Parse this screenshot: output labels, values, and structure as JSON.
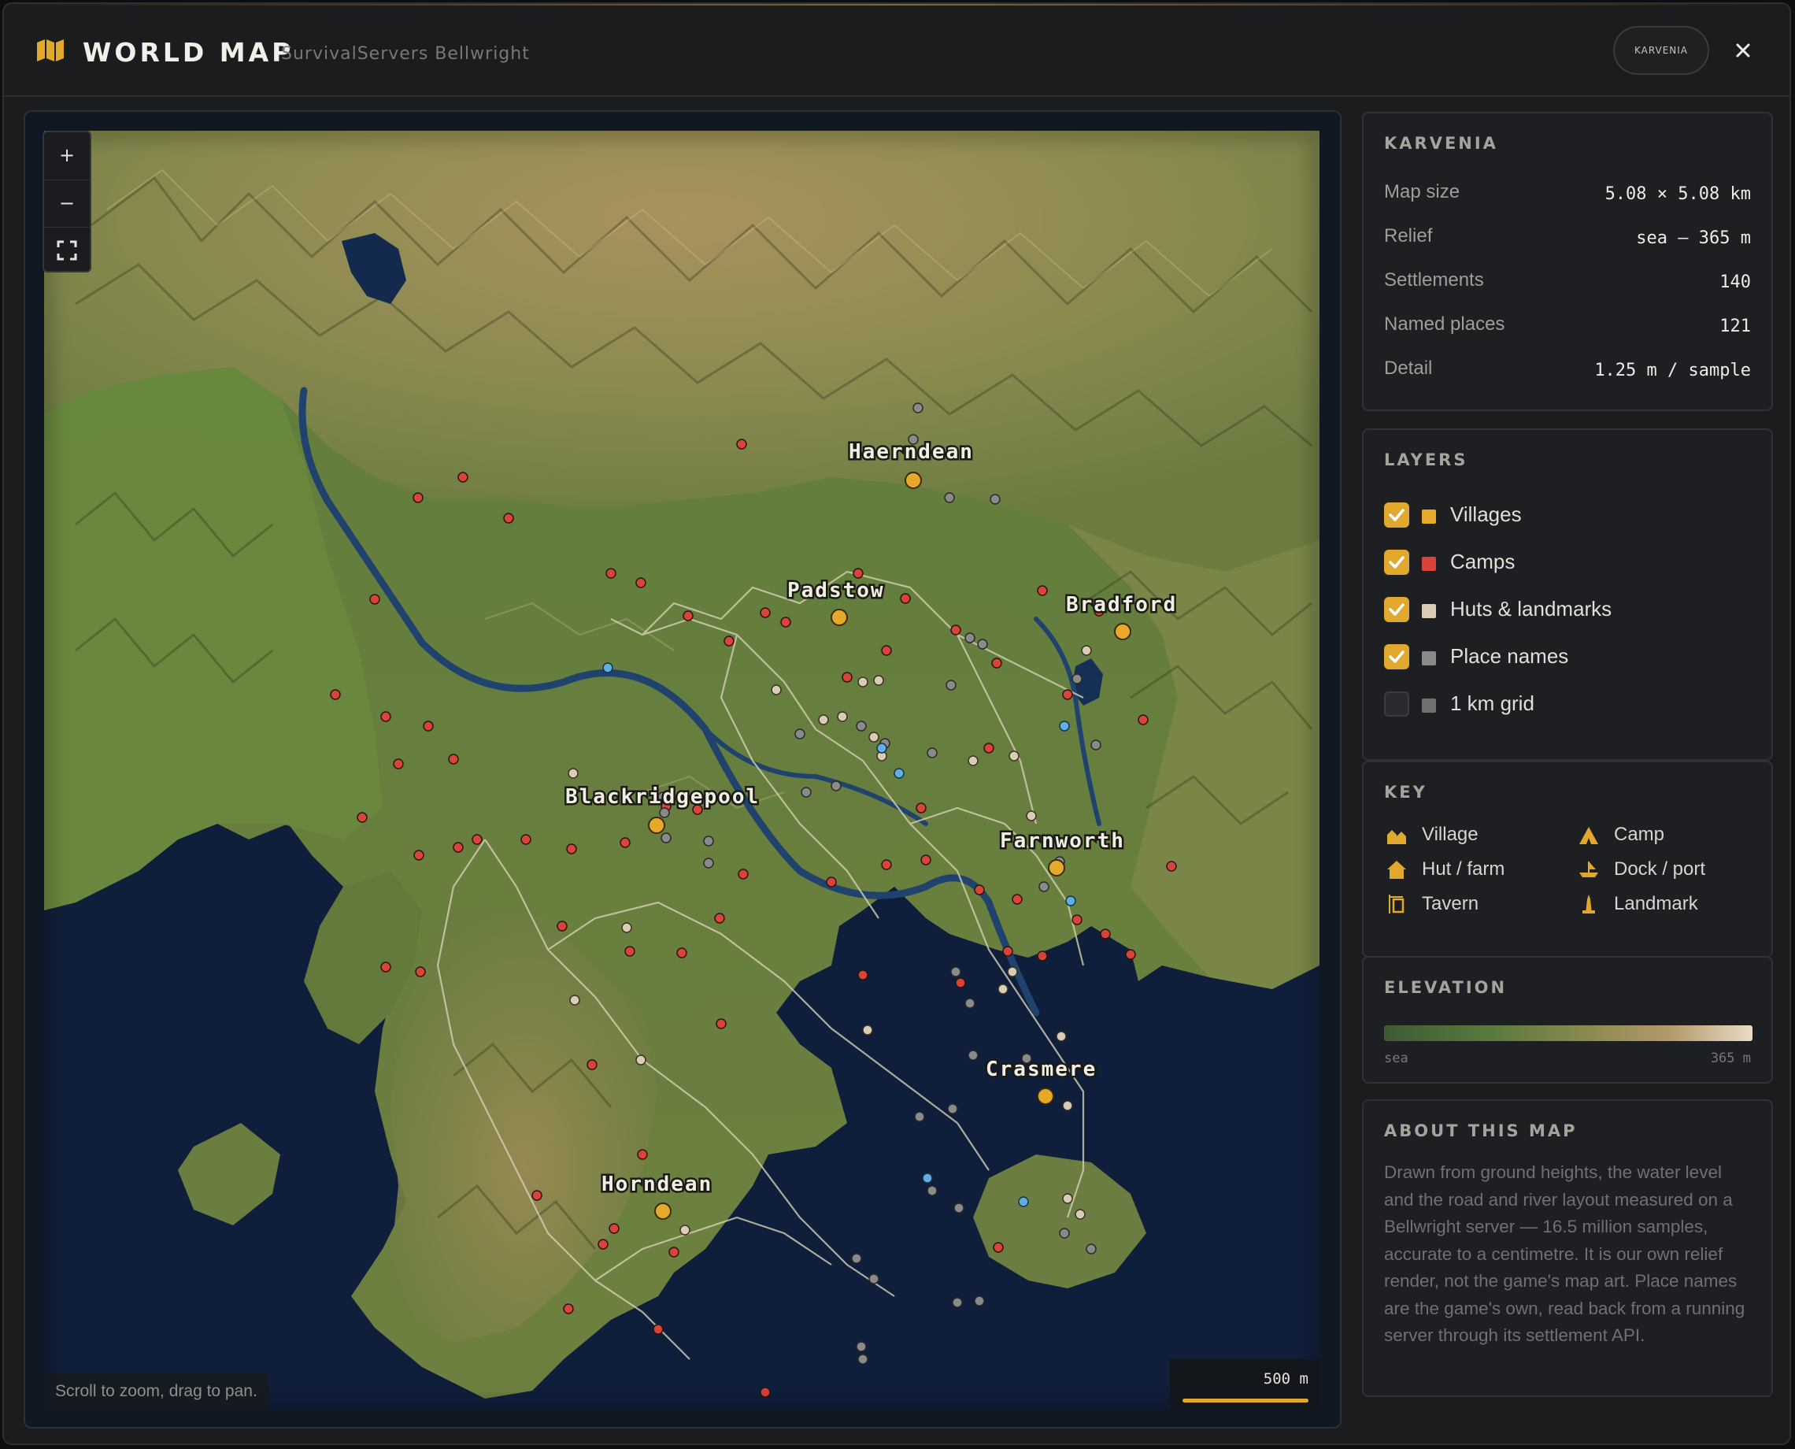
{
  "header": {
    "title": "WORLD MAP",
    "subtitle": "SurvivalServers Bellwright",
    "realm_button": "KARVENIA",
    "close_label": "✕"
  },
  "map": {
    "zoom_in": "+",
    "zoom_out": "−",
    "hint": "Scroll to zoom, drag to pan.",
    "scale_label": "500 m",
    "place_labels": [
      "Haerndean",
      "Padstow",
      "Bradford",
      "Blackridgepool",
      "Farnworth",
      "Crasmere",
      "Horndean"
    ]
  },
  "info": {
    "title": "KARVENIA",
    "rows": [
      {
        "label": "Map size",
        "value": "5.08 × 5.08 km"
      },
      {
        "label": "Relief",
        "value": "sea – 365 m"
      },
      {
        "label": "Settlements",
        "value": "140"
      },
      {
        "label": "Named places",
        "value": "121"
      },
      {
        "label": "Detail",
        "value": "1.25 m / sample"
      }
    ]
  },
  "layers": {
    "title": "LAYERS",
    "items": [
      {
        "label": "Villages",
        "checked": true,
        "color": "#e6a92c"
      },
      {
        "label": "Camps",
        "checked": true,
        "color": "#d9433a"
      },
      {
        "label": "Huts & landmarks",
        "checked": true,
        "color": "#d9cdb5"
      },
      {
        "label": "Place names",
        "checked": true,
        "color": "#8a8a8a"
      },
      {
        "label": "1 km grid",
        "checked": false,
        "color": "#707070"
      }
    ]
  },
  "key": {
    "title": "KEY",
    "items": [
      {
        "label": "Village",
        "icon": "village-icon"
      },
      {
        "label": "Camp",
        "icon": "camp-icon"
      },
      {
        "label": "Hut / farm",
        "icon": "hut-icon"
      },
      {
        "label": "Dock / port",
        "icon": "dock-icon"
      },
      {
        "label": "Tavern",
        "icon": "tavern-icon"
      },
      {
        "label": "Landmark",
        "icon": "landmark-icon"
      }
    ]
  },
  "elevation": {
    "title": "ELEVATION",
    "low_label": "sea",
    "high_label": "365 m"
  },
  "about": {
    "title": "ABOUT THIS MAP",
    "text": "Drawn from ground heights, the water level and the road and river layout measured on a Bellwright server — 16.5 million samples, accurate to a centimetre. It is our own relief render, not the game's map art. Place names are the game's own, read back from a running server through its settlement API."
  },
  "colors": {
    "accent": "#e0a92e",
    "village": "#e6a92c",
    "camp": "#d9433a",
    "hut": "#d9cdb5",
    "place": "#8a8a8a",
    "dock": "#5fb0e0"
  }
}
